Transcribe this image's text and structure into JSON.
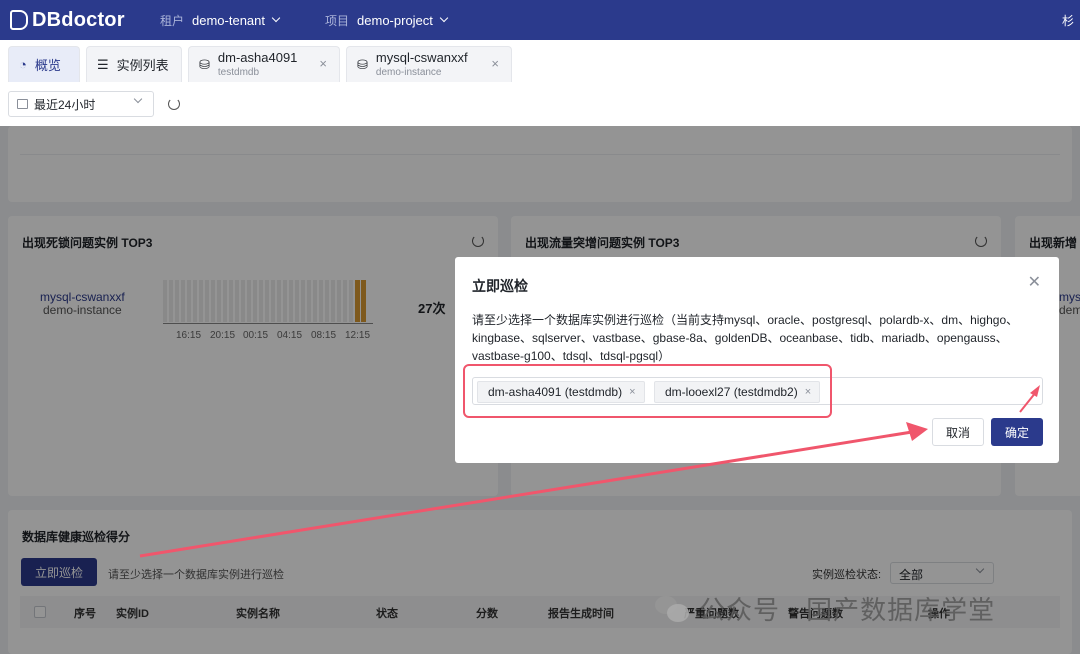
{
  "app": {
    "name": "DBdoctor"
  },
  "topbar": {
    "tenant_label": "租户",
    "tenant_value": "demo-tenant",
    "project_label": "项目",
    "project_value": "demo-project",
    "right_text": "杉"
  },
  "tabs": [
    {
      "label": "概览"
    },
    {
      "label": "实例列表"
    },
    {
      "label": "dm-asha4091",
      "sub": "testdmdb"
    },
    {
      "label": "mysql-cswanxxf",
      "sub": "demo-instance"
    }
  ],
  "filter": {
    "range": "最近24小时"
  },
  "cards": {
    "deadlock": {
      "title": "出现死锁问题实例 TOP3",
      "instance": "mysql-cswanxxf",
      "instance_sub": "demo-instance",
      "count": "27次",
      "ticks": [
        "16:15",
        "20:15",
        "00:15",
        "04:15",
        "08:15",
        "12:15"
      ]
    },
    "traffic": {
      "title": "出现流量突增问题实例 TOP3"
    },
    "new": {
      "title": "出现新增",
      "instance_prefix": "mys",
      "instance_sub_prefix": "dem"
    }
  },
  "health": {
    "title": "数据库健康巡检得分",
    "button": "立即巡检",
    "hint": "请至少选择一个数据库实例进行巡检",
    "status_label": "实例巡检状态:",
    "status_value": "全部",
    "columns": [
      "序号",
      "实例ID",
      "实例名称",
      "状态",
      "分数",
      "报告生成时间",
      "严重问题数",
      "警告问题数",
      "操作"
    ]
  },
  "modal": {
    "title": "立即巡检",
    "description": "请至少选择一个数据库实例进行巡检（当前支持mysql、oracle、postgresql、polardb-x、dm、highgo、kingbase、sqlserver、vastbase、gbase-8a、goldenDB、oceanbase、tidb、mariadb、opengauss、vastbase-g100、tdsql、tdsql-pgsql）",
    "selected": [
      "dm-asha4091 (testdmdb)",
      "dm-looexl27 (testdmdb2)"
    ],
    "cancel": "取消",
    "confirm": "确定"
  },
  "watermark": {
    "text": "公众号 · 国产数据库学堂"
  },
  "colors": {
    "brand": "#2b3a8c",
    "annotation": "#f0566c",
    "heat": "#d99a33"
  }
}
